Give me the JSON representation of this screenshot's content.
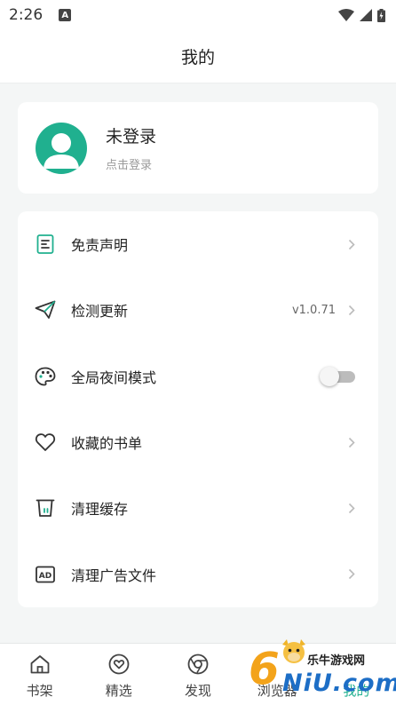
{
  "status_bar": {
    "time": "2:26",
    "notification_letter": "A"
  },
  "app_bar": {
    "title": "我的"
  },
  "profile": {
    "name": "未登录",
    "hint": "点击登录"
  },
  "menu": [
    {
      "label": "免责声明",
      "icon": "document-icon",
      "trailing": "chevron"
    },
    {
      "label": "检测更新",
      "icon": "send-icon",
      "value": "v1.0.71",
      "trailing": "chevron"
    },
    {
      "label": "全局夜间模式",
      "icon": "palette-icon",
      "trailing": "toggle",
      "toggle_on": false
    },
    {
      "label": "收藏的书单",
      "icon": "heart-icon",
      "trailing": "chevron"
    },
    {
      "label": "清理缓存",
      "icon": "trash-icon",
      "trailing": "chevron"
    },
    {
      "label": "清理广告文件",
      "icon": "ad-icon",
      "trailing": "chevron"
    }
  ],
  "bottom_nav": [
    {
      "label": "书架",
      "icon": "home-icon"
    },
    {
      "label": "精选",
      "icon": "heart-circle-icon"
    },
    {
      "label": "发现",
      "icon": "compass-icon"
    },
    {
      "label": "浏览器",
      "icon": "browser-icon"
    },
    {
      "label": "我的",
      "icon": "profile-icon",
      "active": true
    }
  ],
  "watermark": {
    "digit": "6",
    "brand": "乐牛游戏网",
    "site": "NiU.com"
  },
  "colors": {
    "accent": "#20b08f",
    "background": "#f4f6f6",
    "card": "#ffffff"
  }
}
